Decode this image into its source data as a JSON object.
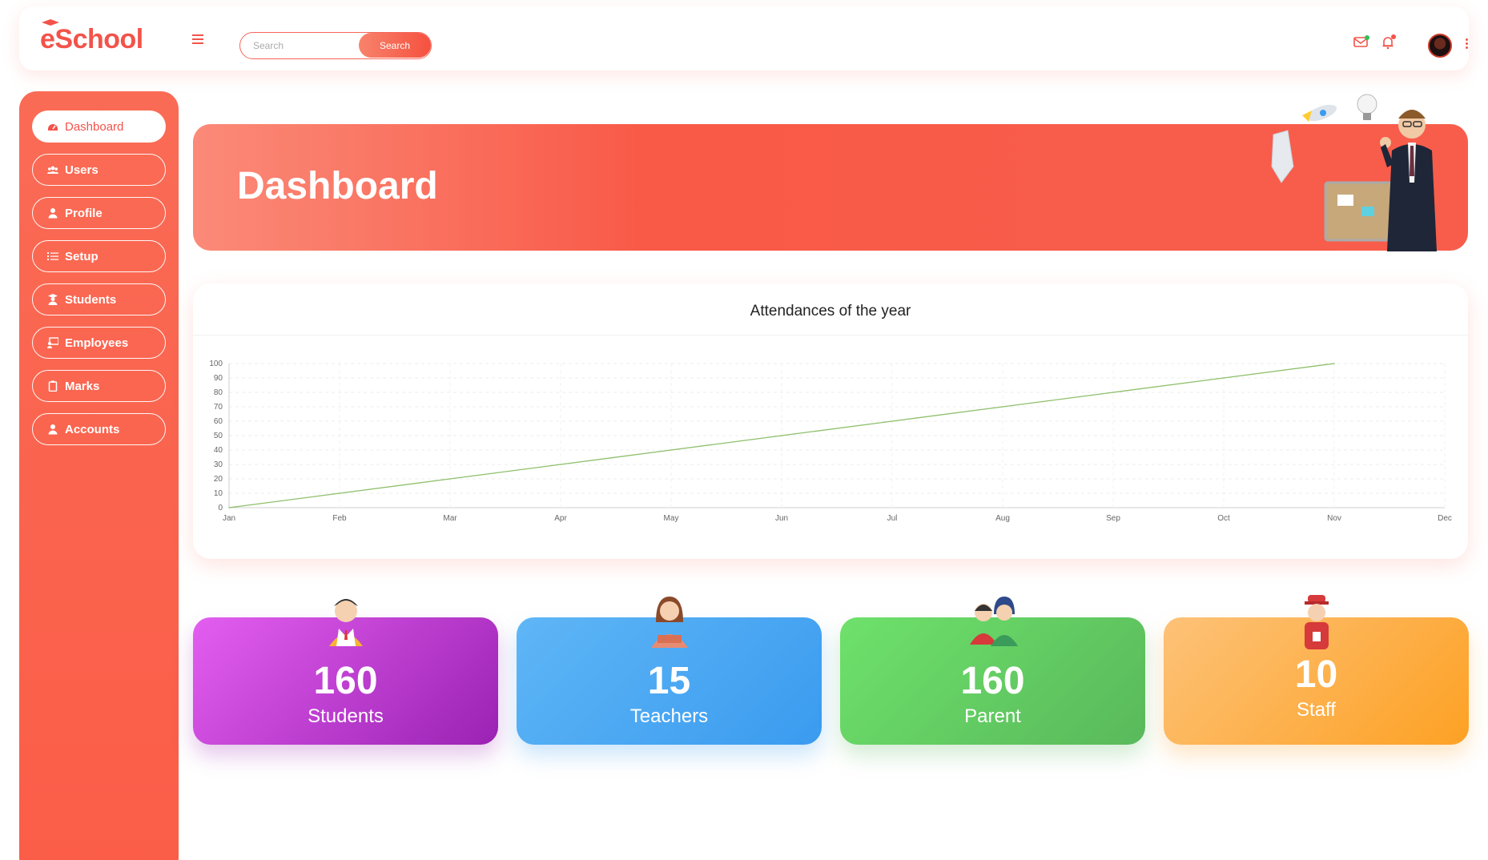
{
  "app": {
    "logo_text": "eSchool",
    "brand_color": "#f2534a"
  },
  "topbar": {
    "search": {
      "placeholder": "Search",
      "button_label": "Search"
    },
    "icons": [
      "menu-icon",
      "mail-icon",
      "bell-icon",
      "avatar",
      "kebab-icon"
    ]
  },
  "sidebar": {
    "items": [
      {
        "label": "Dashboard",
        "icon": "dashboard-icon",
        "active": true
      },
      {
        "label": "Users",
        "icon": "users-icon"
      },
      {
        "label": "Profile",
        "icon": "user-icon"
      },
      {
        "label": "Setup",
        "icon": "list-icon"
      },
      {
        "label": "Students",
        "icon": "graduate-icon"
      },
      {
        "label": "Employees",
        "icon": "teacher-icon"
      },
      {
        "label": "Marks",
        "icon": "clipboard-icon"
      },
      {
        "label": "Accounts",
        "icon": "user-icon"
      }
    ]
  },
  "banner": {
    "title": "Dashboard"
  },
  "chart_data": {
    "type": "line",
    "title": "Attendances of the year",
    "x": [
      "Jan",
      "Feb",
      "Mar",
      "Apr",
      "May",
      "Jun",
      "Jul",
      "Aug",
      "Sep",
      "Oct",
      "Nov",
      "Dec"
    ],
    "series": [
      {
        "values": [
          0,
          10,
          20,
          30,
          40,
          50,
          60,
          70,
          80,
          90,
          100
        ],
        "color": "#8dbf6a"
      }
    ],
    "ylim": [
      0,
      100
    ],
    "yticks": [
      0,
      10,
      20,
      30,
      40,
      50,
      60,
      70,
      80,
      90,
      100
    ],
    "grid": true,
    "legend": "none"
  },
  "stats": [
    {
      "value": "160",
      "label": "Students",
      "color_from": "#e35ef0",
      "color_to": "#9a22b3"
    },
    {
      "value": "15",
      "label": "Teachers",
      "color_from": "#5fb6f6",
      "color_to": "#3a9bef"
    },
    {
      "value": "160",
      "label": "Parent",
      "color_from": "#6ee16b",
      "color_to": "#59b95b"
    },
    {
      "value": "10",
      "label": "Staff",
      "color_from": "#fdc278",
      "color_to": "#fda124"
    }
  ]
}
